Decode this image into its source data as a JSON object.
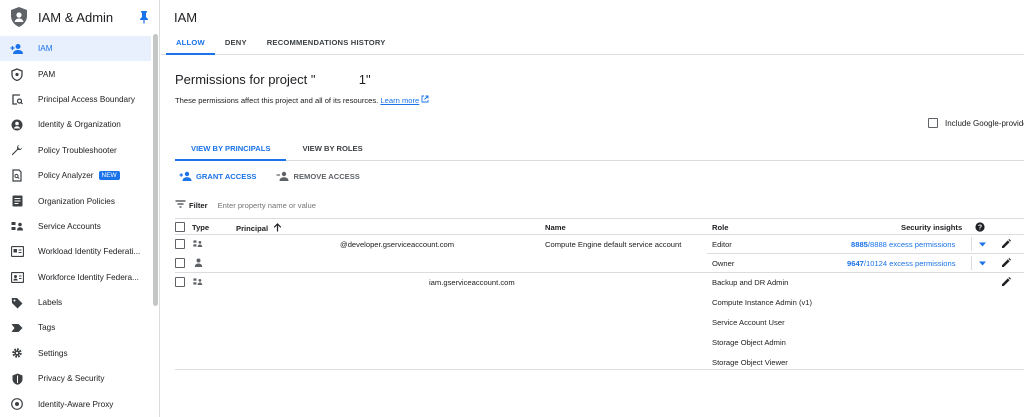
{
  "sidebar": {
    "title": "IAM & Admin",
    "logo_icon": "shield-user-icon",
    "pin_icon": "pin-icon",
    "items": [
      {
        "label": "IAM",
        "icon": "person-add-icon",
        "active": true
      },
      {
        "label": "PAM",
        "icon": "shield-lock-icon"
      },
      {
        "label": "Principal Access Boundary",
        "icon": "boundary-icon"
      },
      {
        "label": "Identity & Organization",
        "icon": "account-circle-icon"
      },
      {
        "label": "Policy Troubleshooter",
        "icon": "wrench-icon"
      },
      {
        "label": "Policy Analyzer",
        "icon": "document-search-icon",
        "badge": "NEW"
      },
      {
        "label": "Organization Policies",
        "icon": "document-list-icon"
      },
      {
        "label": "Service Accounts",
        "icon": "service-account-icon"
      },
      {
        "label": "Workload Identity Federati...",
        "icon": "workload-identity-icon"
      },
      {
        "label": "Workforce Identity Federa...",
        "icon": "workforce-identity-icon"
      },
      {
        "label": "Labels",
        "icon": "label-icon"
      },
      {
        "label": "Tags",
        "icon": "tag-icon"
      },
      {
        "label": "Settings",
        "icon": "gear-icon"
      },
      {
        "label": "Privacy & Security",
        "icon": "privacy-shield-icon"
      },
      {
        "label": "Identity-Aware Proxy",
        "icon": "proxy-icon"
      }
    ]
  },
  "main": {
    "title": "IAM",
    "tabs": [
      {
        "label": "ALLOW",
        "active": true
      },
      {
        "label": "DENY"
      },
      {
        "label": "RECOMMENDATIONS HISTORY"
      }
    ],
    "perm_title": "Permissions for project \"            1\"",
    "perm_desc": "These permissions affect this project and all of its resources.",
    "learn_more": "Learn more",
    "include_google": "Include Google-provide",
    "subtabs": [
      {
        "label": "VIEW BY PRINCIPALS",
        "active": true
      },
      {
        "label": "VIEW BY ROLES"
      }
    ],
    "grant_access": "GRANT ACCESS",
    "remove_access": "REMOVE ACCESS",
    "filter_label": "Filter",
    "filter_placeholder": "Enter property name or value"
  },
  "table": {
    "headers": {
      "type": "Type",
      "principal": "Principal",
      "name": "Name",
      "role": "Role",
      "insights": "Security insights"
    },
    "rows": [
      {
        "type_icon": "service-account-icon",
        "principal": "@developer.gserviceaccount.com",
        "name": "Compute Engine default service account",
        "roles": [
          {
            "role": "Editor",
            "insight_bold": "8885",
            "insight_rest": "/8888 excess permissions"
          }
        ]
      },
      {
        "type_icon": "person-icon",
        "principal": "",
        "name": "",
        "roles": [
          {
            "role": "Owner",
            "insight_bold": "9647",
            "insight_rest": "/10124 excess permissions"
          }
        ]
      },
      {
        "type_icon": "service-account-icon",
        "principal": "iam.gserviceaccount.com",
        "name": "",
        "roles": [
          {
            "role": "Backup and DR Admin"
          },
          {
            "role": "Compute Instance Admin (v1)"
          },
          {
            "role": "Service Account User"
          },
          {
            "role": "Storage Object Admin"
          },
          {
            "role": "Storage Object Viewer"
          }
        ]
      }
    ]
  },
  "colors": {
    "accent": "#1a73e8",
    "active_bg": "#e8f0fe",
    "divider": "#dadce0"
  }
}
